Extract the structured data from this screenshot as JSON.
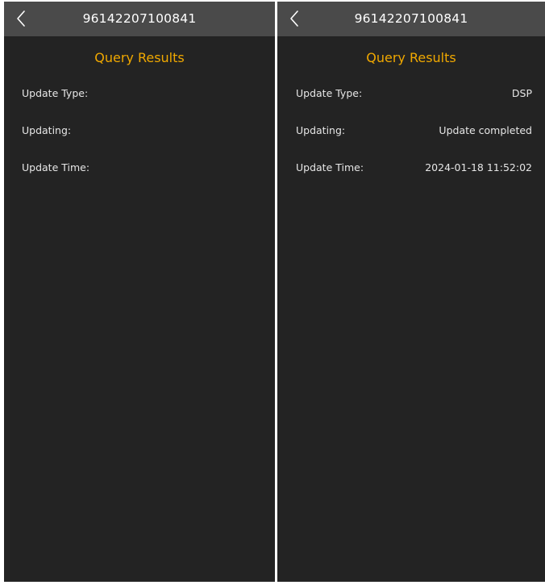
{
  "screens": [
    {
      "nav": {
        "title": "96142207100841"
      },
      "section_title": "Query Results",
      "fields": [
        {
          "label": "Update Type:",
          "value": ""
        },
        {
          "label": "Updating:",
          "value": ""
        },
        {
          "label": "Update Time:",
          "value": ""
        }
      ]
    },
    {
      "nav": {
        "title": "96142207100841"
      },
      "section_title": "Query Results",
      "fields": [
        {
          "label": "Update Type:",
          "value": "DSP"
        },
        {
          "label": "Updating:",
          "value": "Update completed"
        },
        {
          "label": "Update Time:",
          "value": "2024-01-18 11:52:02"
        }
      ]
    }
  ],
  "colors": {
    "background": "#232323",
    "navbar": "#4a4a4a",
    "accent": "#f0a800",
    "text": "#e6e6e6"
  },
  "icons": {
    "back": "chevron-left-icon"
  }
}
